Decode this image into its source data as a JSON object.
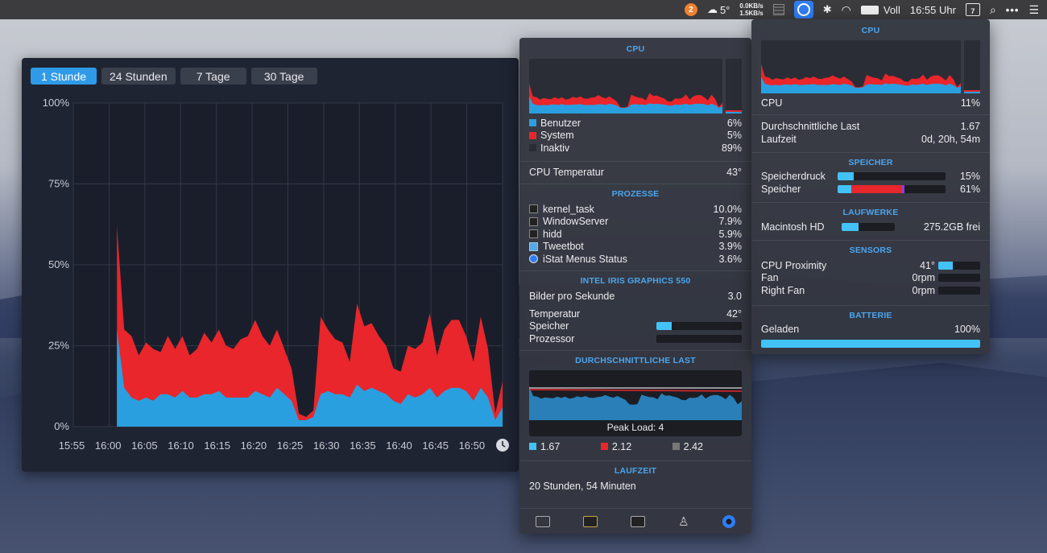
{
  "menubar": {
    "badge": "2",
    "weather_temp": "5°",
    "net_up": "0.0KB/s",
    "net_down": "1.5KB/s",
    "battery_label": "Voll",
    "clock": "16:55 Uhr",
    "calendar_day": "7"
  },
  "history": {
    "tabs": [
      "1 Stunde",
      "24 Stunden",
      "7 Tage",
      "30 Tage"
    ],
    "active_tab": 0
  },
  "chart_data": {
    "type": "area",
    "y_ticks": [
      "100%",
      "75%",
      "50%",
      "25%",
      "0%"
    ],
    "x_ticks": [
      "15:55",
      "16:00",
      "16:05",
      "16:10",
      "16:15",
      "16:20",
      "16:25",
      "16:30",
      "16:35",
      "16:40",
      "16:45",
      "16:50"
    ],
    "ylim": [
      0,
      100
    ],
    "series": [
      {
        "name": "System",
        "color": "#e8262b"
      },
      {
        "name": "Benutzer",
        "color": "#2a9fe0"
      }
    ],
    "x_minutes": [
      0,
      1,
      2,
      3,
      4,
      5,
      6,
      7,
      8,
      9,
      10,
      11,
      12,
      13,
      14,
      15,
      16,
      17,
      18,
      19,
      20,
      21,
      22,
      23,
      24,
      25,
      26,
      27,
      28,
      29,
      30,
      31,
      32,
      33,
      34,
      35,
      36,
      37,
      38,
      39,
      40,
      41,
      42,
      43,
      44,
      45,
      46,
      47,
      48,
      49,
      50,
      51,
      52,
      53,
      54,
      55,
      56,
      57,
      58,
      59
    ],
    "total_values": [
      null,
      null,
      null,
      null,
      null,
      null,
      62,
      30,
      28,
      22,
      26,
      24,
      23,
      28,
      24,
      28,
      22,
      24,
      29,
      26,
      30,
      25,
      24,
      27,
      28,
      33,
      28,
      25,
      30,
      24,
      18,
      4,
      3,
      5,
      34,
      30,
      27,
      26,
      20,
      38,
      31,
      32,
      28,
      25,
      18,
      17,
      25,
      24,
      26,
      35,
      22,
      30,
      33,
      33,
      28,
      20,
      34,
      24,
      4,
      14
    ],
    "user_values": [
      null,
      null,
      null,
      null,
      null,
      null,
      30,
      12,
      9,
      8,
      9,
      8,
      10,
      10,
      9,
      11,
      9,
      9,
      10,
      10,
      11,
      9,
      9,
      9,
      9,
      11,
      10,
      9,
      12,
      10,
      8,
      2,
      2,
      3,
      10,
      11,
      10,
      10,
      9,
      13,
      11,
      12,
      11,
      10,
      8,
      7,
      10,
      9,
      10,
      12,
      9,
      11,
      12,
      12,
      11,
      8,
      12,
      9,
      2,
      6
    ]
  },
  "cpu_panel": {
    "title": "CPU",
    "legend": [
      {
        "label": "Benutzer",
        "value": "6%",
        "color": "#2a9fe0"
      },
      {
        "label": "System",
        "value": "5%",
        "color": "#e8262b"
      },
      {
        "label": "Inaktiv",
        "value": "89%",
        "color": "#2a2c33"
      }
    ],
    "temp_label": "CPU Temperatur",
    "temp_value": "43°",
    "proc_title": "PROZESSE",
    "processes": [
      {
        "name": "kernel_task",
        "value": "10.0%",
        "icon": "terminal-icon"
      },
      {
        "name": "WindowServer",
        "value": "7.9%",
        "icon": "terminal-icon"
      },
      {
        "name": "hidd",
        "value": "5.9%",
        "icon": "terminal-icon"
      },
      {
        "name": "Tweetbot",
        "value": "3.9%",
        "icon": "tweetbot-icon"
      },
      {
        "name": "iStat Menus Status",
        "value": "3.6%",
        "icon": "istat-icon"
      }
    ],
    "gpu_title": "INTEL IRIS GRAPHICS 550",
    "fps_label": "Bilder pro Sekunde",
    "fps_value": "3.0",
    "gpu_temp_label": "Temperatur",
    "gpu_temp_value": "42°",
    "gpu_mem_label": "Speicher",
    "gpu_mem_level": 0.18,
    "gpu_proc_label": "Prozessor",
    "gpu_proc_level": 0.0,
    "load_title": "DURCHSCHNITTLICHE LAST",
    "peak_label": "Peak Load: 4",
    "loads": [
      {
        "value": "1.67",
        "color": "#43c2f7"
      },
      {
        "value": "2.12",
        "color": "#e8262b"
      },
      {
        "value": "2.42",
        "color": "#777777"
      }
    ],
    "uptime_title": "LAUFZEIT",
    "uptime_value": "20 Stunden, 54 Minuten"
  },
  "summary_panel": {
    "cpu_title": "CPU",
    "cpu_label": "CPU",
    "cpu_value": "11%",
    "avg_load_label": "Durchschnittliche Last",
    "avg_load_value": "1.67",
    "uptime_label": "Laufzeit",
    "uptime_value": "0d, 20h, 54m",
    "mem_title": "SPEICHER",
    "pressure_label": "Speicherdruck",
    "pressure_value": "15%",
    "pressure_level": 0.15,
    "memory_label": "Speicher",
    "memory_value": "61%",
    "memory_levels": [
      0.13,
      0.47,
      0.02
    ],
    "disk_title": "LAUFWERKE",
    "disk_label": "Macintosh HD",
    "disk_value": "275.2GB frei",
    "disk_level": 0.32,
    "sensors_title": "SENSORS",
    "sensors": [
      {
        "label": "CPU Proximity",
        "value": "41°",
        "level": 0.35
      },
      {
        "label": "Fan",
        "value": "0rpm",
        "level": 0
      },
      {
        "label": "Right Fan",
        "value": "0rpm",
        "level": 0
      }
    ],
    "battery_title": "BATTERIE",
    "battery_label": "Geladen",
    "battery_value": "100%",
    "battery_level": 1.0
  }
}
